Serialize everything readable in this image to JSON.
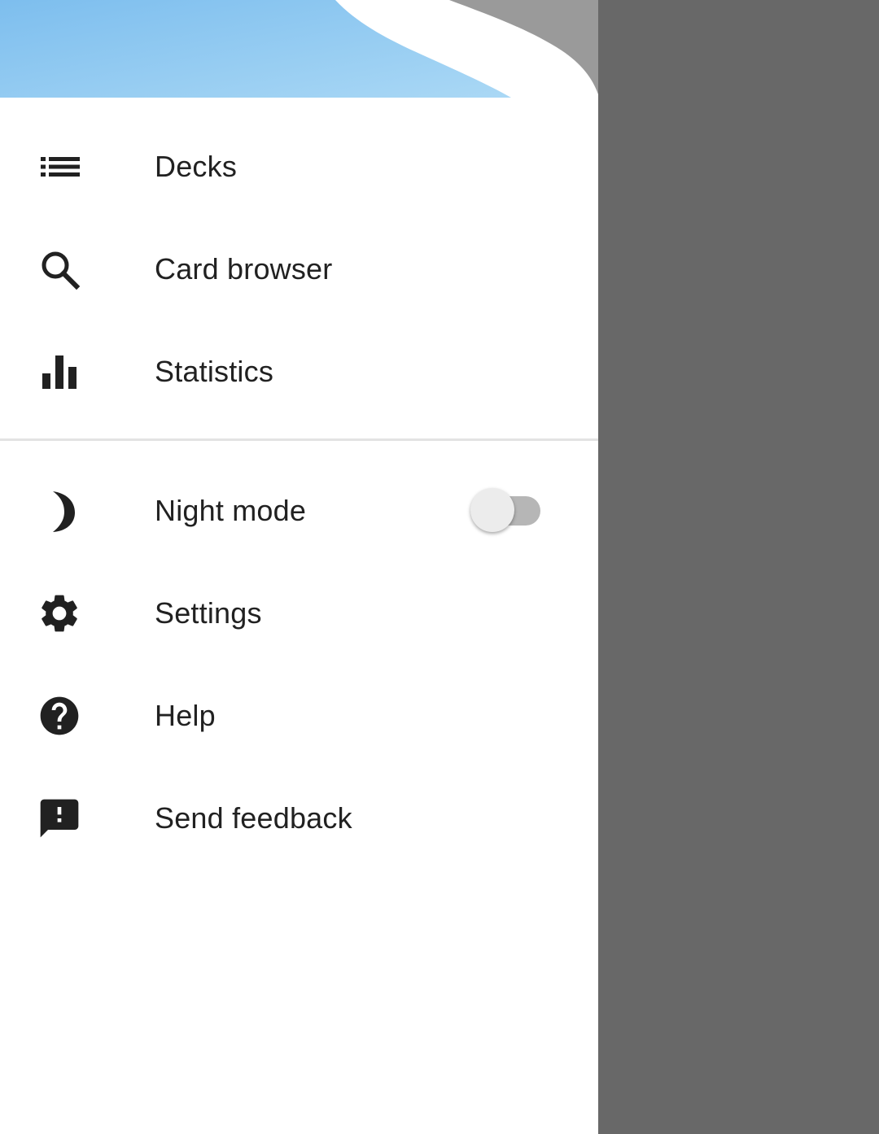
{
  "colors": {
    "header_blue_start": "#7dbeee",
    "header_blue_end": "#aad8f5",
    "scrim": "#686868",
    "text": "#212121",
    "icon": "#212121",
    "divider": "#e3e3e3"
  },
  "drawer": {
    "primary_items": [
      {
        "label": "Decks",
        "icon": "list-icon"
      },
      {
        "label": "Card browser",
        "icon": "search-icon"
      },
      {
        "label": "Statistics",
        "icon": "bar-chart-icon"
      }
    ],
    "secondary_items": [
      {
        "label": "Night mode",
        "icon": "moon-icon",
        "toggle": false
      },
      {
        "label": "Settings",
        "icon": "gear-icon"
      },
      {
        "label": "Help",
        "icon": "help-icon"
      },
      {
        "label": "Send feedback",
        "icon": "feedback-icon"
      }
    ]
  }
}
